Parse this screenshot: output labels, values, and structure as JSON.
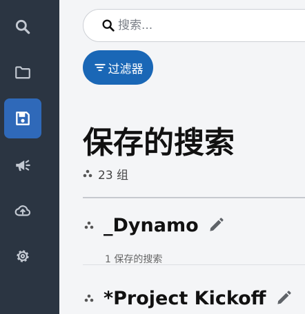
{
  "sidebar": {
    "items": [
      {
        "name": "search",
        "icon": "search-icon",
        "active": false
      },
      {
        "name": "folder",
        "icon": "folder-icon",
        "active": false
      },
      {
        "name": "saved",
        "icon": "save-icon",
        "active": true
      },
      {
        "name": "announcements",
        "icon": "megaphone-icon",
        "active": false
      },
      {
        "name": "upload",
        "icon": "cloud-upload-icon",
        "active": false
      },
      {
        "name": "settings",
        "icon": "gear-icon",
        "active": false
      }
    ],
    "colors": {
      "background": "#2b3542",
      "active": "#2f69b9",
      "icon": "#c3c9d2",
      "active_icon": "#ffffff"
    }
  },
  "search": {
    "placeholder": "搜索...",
    "value": ""
  },
  "filter": {
    "label": "过滤器",
    "color": "#1a67b6"
  },
  "page": {
    "title": "保存的搜索",
    "group_count": "23 组"
  },
  "groups": [
    {
      "name": "_Dynamo",
      "subtitle": "1 保存的搜索"
    },
    {
      "name": "*Project Kickoff",
      "subtitle": ""
    }
  ]
}
